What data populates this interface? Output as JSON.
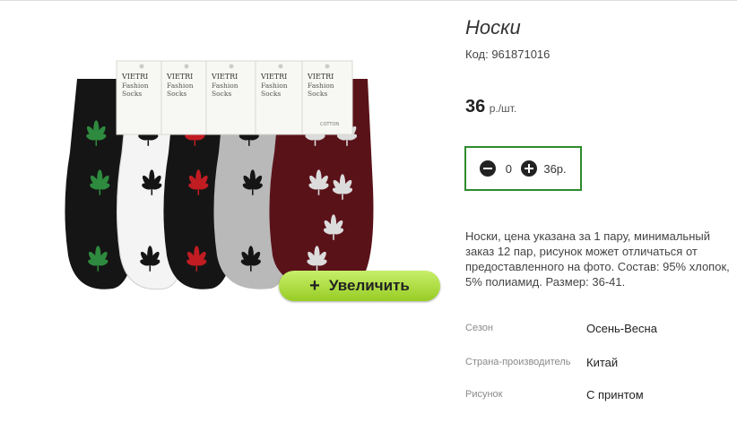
{
  "product": {
    "title": "Носки",
    "code": "Код: 961871016",
    "price_value": "36",
    "price_unit": "р./шт.",
    "description": "Носки, цена указана за 1 пару, минимальный заказ 12 пар, рисунок может отличаться от предоставленного на фото. Состав: 95% хлопок, 5% полиамид. Размер: 36-41."
  },
  "quantity": {
    "value": "0",
    "total": "36р."
  },
  "image": {
    "zoom_label": "Увеличить",
    "zoom_plus": "+",
    "tag_brand": "VIETRI",
    "tag_line1": "Fashion",
    "tag_line2": "Socks",
    "tag_small": "COTTON",
    "sock_colors": [
      "#151515",
      "#f4f4f4",
      "#151515",
      "#b9b9b9",
      "#5a1219"
    ],
    "leaf_colors": [
      "#2e8a3e",
      "#151515",
      "#c01c22",
      "#151515",
      "#dcdcdc"
    ]
  },
  "specs": [
    {
      "label": "Сезон",
      "value": "Осень-Весна"
    },
    {
      "label": "Страна-производитель",
      "value": "Китай"
    },
    {
      "label": "Рисунок",
      "value": "С принтом"
    }
  ]
}
